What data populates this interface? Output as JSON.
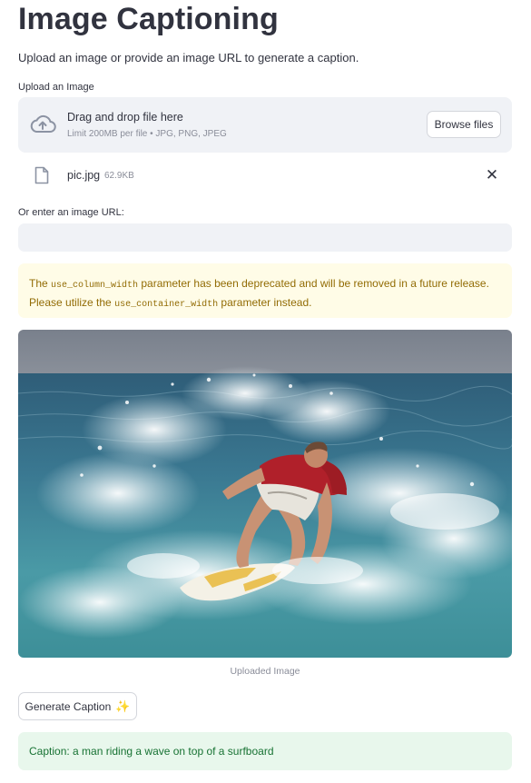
{
  "page": {
    "title": "Image Captioning",
    "subtitle": "Upload an image or provide an image URL to generate a caption."
  },
  "uploader": {
    "label": "Upload an Image",
    "drop_text": "Drag and drop file here",
    "limit_text": "Limit 200MB per file • JPG, PNG, JPEG",
    "browse_label": "Browse files",
    "icon": "cloud-upload-icon"
  },
  "uploaded_file": {
    "name": "pic.jpg",
    "size": "62.9KB",
    "icon": "file-icon",
    "remove_glyph": "✕"
  },
  "url_field": {
    "label": "Or enter an image URL:",
    "value": "",
    "placeholder": ""
  },
  "warning": {
    "text_1": "The ",
    "code_1": "use_column_width",
    "text_2": " parameter has been deprecated and will be removed in a future release. Please utilize the ",
    "code_2": "use_container_width",
    "text_3": " parameter instead."
  },
  "image": {
    "caption": "Uploaded Image"
  },
  "generate_button": {
    "label": "Generate Caption",
    "emoji": "✨"
  },
  "result": {
    "text": "Caption: a man riding a wave on top of a surfboard"
  },
  "colors": {
    "warning_bg": "#fffce7",
    "warning_text": "#926c05",
    "success_bg": "#e8f7ec",
    "success_text": "#177233",
    "input_bg": "#f0f2f6"
  }
}
